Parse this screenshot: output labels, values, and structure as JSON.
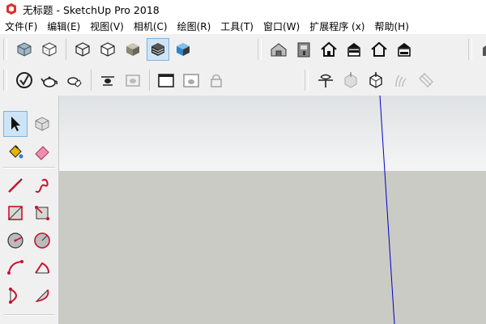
{
  "window": {
    "title": "无标题 - SketchUp Pro 2018"
  },
  "menu": {
    "items": [
      "文件(F)",
      "编辑(E)",
      "视图(V)",
      "相机(C)",
      "绘图(R)",
      "工具(T)",
      "窗口(W)",
      "扩展程序 (x)",
      "帮助(H)"
    ]
  },
  "toolbars": {
    "row1_styles": [
      "xray-icon",
      "back-edges-icon",
      "wireframe-icon",
      "hidden-line-icon",
      "shaded-icon",
      "shaded-with-textures-icon",
      "monochrome-icon"
    ],
    "row1_styles_active": "shaded-with-textures-icon",
    "row1_warehouse": [
      "3d-warehouse-icon",
      "extension-warehouse-icon",
      "home-view-icon",
      "get-models-icon",
      "share-model-icon",
      "share-component-icon"
    ],
    "row2_getting_started": [
      "getting-started-icon",
      "teapot-icon",
      "teapot-hand-icon",
      "scene-icon",
      "scene-settings-icon",
      "window-icon",
      "window-teapot-icon",
      "lock-icon"
    ],
    "row2_sandbox": [
      "section-plane-icon",
      "show-section-icon",
      "section-cut-icon",
      "smoove-icon",
      "stamp-icon"
    ]
  },
  "left_toolbar": {
    "tools": [
      [
        "select-arrow-icon",
        "make-component-icon"
      ],
      [
        "paint-bucket-icon",
        "eraser-icon"
      ],
      [
        "pencil-line-icon",
        "freehand-icon"
      ],
      [
        "rectangle-icon",
        "rotated-rectangle-icon"
      ],
      [
        "circle-icon",
        "polygon-icon"
      ],
      [
        "arc-icon",
        "two-point-arc-icon"
      ],
      [
        "three-point-arc-icon",
        "pie-icon"
      ]
    ],
    "active_tool": "select-arrow-icon"
  },
  "viewport": {
    "colors": {
      "sky": "#e8ebec",
      "ground": "#cbcbc5",
      "axis_blue": "#0000c8"
    }
  },
  "colors": {
    "app_icon_red": "#d9332d",
    "curve_red": "#c8102e",
    "toolbar_bg": "#f0f0f0",
    "active_bg": "#cde4f7"
  }
}
